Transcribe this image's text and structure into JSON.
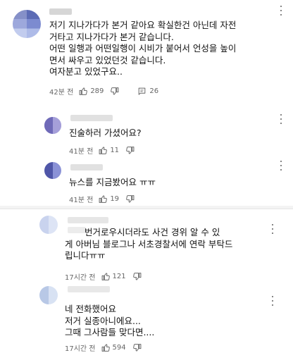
{
  "comments": [
    {
      "text": "저기 지나가다가 본거 같아요 확실한건 아닌데 자전\n거타고 지나가다가 본거 같습니다.\n어떤 일행과 어떤일행이 시비가 붙어서 언성을 높이\n면서 싸우고 있었던것 같습니다.\n여자분고 있었구요..",
      "time": "42분 전",
      "likes": "289",
      "replies": "26"
    },
    {
      "text": "진술하러 가셨어요?",
      "time": "41분 전",
      "likes": "11"
    },
    {
      "text": "뉴스를 지금봤어요 ㅠㅠ",
      "time": "41분 전",
      "likes": "19"
    },
    {
      "text": "번거로우시더라도 사건 경위 알 수 있\n게 아버님 블로그나 서초경찰서에 연락 부탁드\n립니다ㅠㅠ",
      "time": "17시간 전",
      "likes": "121"
    },
    {
      "text": "네 전화했어요\n저거 실종아니에요...\n그때 그사람들 맞다면....",
      "time": "17시간 전",
      "likes": "594"
    }
  ],
  "colors": {
    "muted": "#666666",
    "text": "#111111",
    "avatar_blur": [
      "#5c6bb5",
      "#9aa9e0",
      "#c9d3f0"
    ]
  }
}
